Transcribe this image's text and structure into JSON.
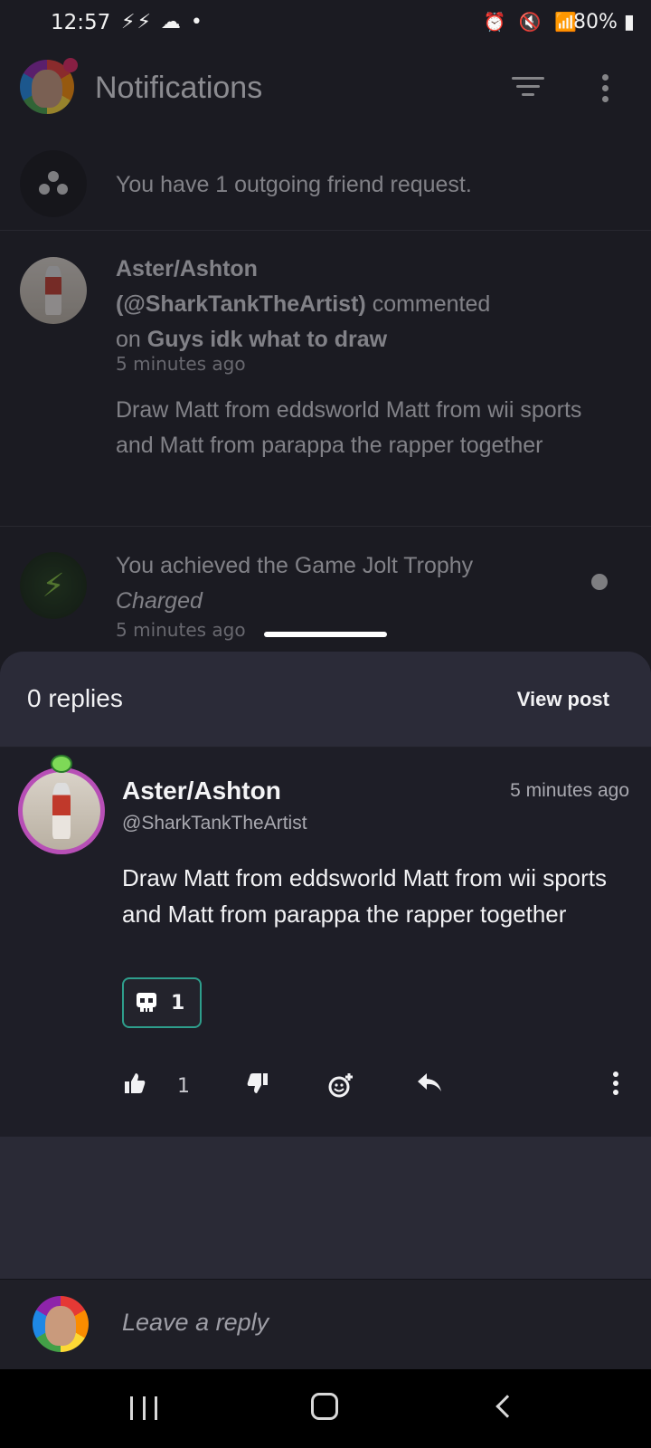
{
  "status_bar": {
    "time": "12:57",
    "left_icons": "⚡⚡ ☁ •",
    "battery": "80%"
  },
  "header": {
    "title": "Notifications"
  },
  "notifications": {
    "friend_request": "You have 1 outgoing friend request.",
    "comment": {
      "author": "Aster/Ashton",
      "handle": "(@SharkTankTheArtist)",
      "action": "commented",
      "preposition": "on",
      "post_title": "Guys idk what to draw",
      "time": "5 minutes ago",
      "body": "Draw Matt from eddsworld Matt from wii sports and Matt from parappa the rapper together"
    },
    "trophy": {
      "text": "You achieved the Game Jolt Trophy",
      "trophy_name": "Charged",
      "time": "5 minutes ago"
    }
  },
  "sheet": {
    "replies_label": "0 replies",
    "view_post_label": "View post",
    "comment": {
      "author": "Aster/Ashton",
      "handle": "@SharkTankTheArtist",
      "time": "5 minutes ago",
      "body": "Draw Matt from eddsworld Matt from wii sports and Matt from parappa the rapper together",
      "reaction_count": "1",
      "like_count": "1"
    },
    "reply_placeholder": "Leave a reply"
  },
  "colors": {
    "background": "#1b1b22",
    "sheet": "#2a2a36",
    "reaction_border": "#2e9e8c",
    "avatar_ring": "#b74fb6",
    "notification_badge": "#e0245e"
  }
}
